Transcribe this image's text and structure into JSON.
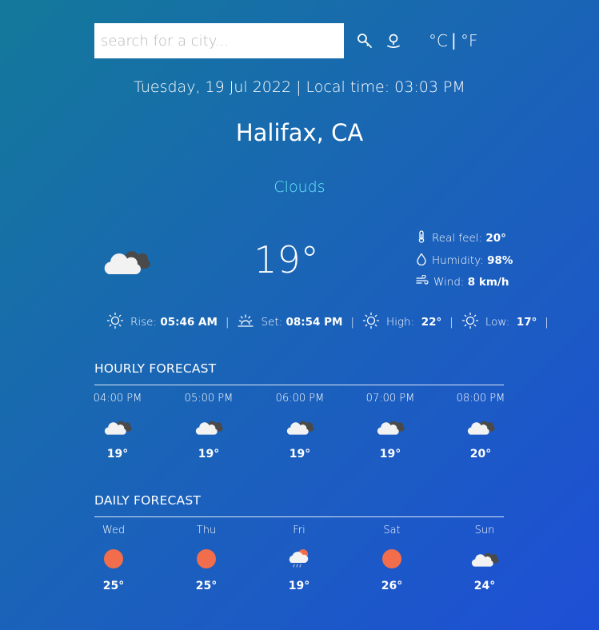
{
  "search": {
    "placeholder": "search for a city..."
  },
  "icons": {
    "search": "search-icon",
    "location": "location-icon",
    "thermometer": "thermometer-icon",
    "humidity": "droplet-icon",
    "wind": "wind-icon",
    "sun": "sun-icon",
    "sunset": "sunset-icon"
  },
  "units": {
    "celsius": "°C",
    "separator": "|",
    "fahrenheit": "°F"
  },
  "datetime": "Tuesday, 19 Jul 2022 | Local time: 03:03 PM",
  "city": "Halifax, CA",
  "condition": "Clouds",
  "current": {
    "temp": "19°",
    "icon": "clouds-icon",
    "real_feel_label": "Real feel:",
    "real_feel_value": "20°",
    "humidity_label": "Humidity:",
    "humidity_value": "98%",
    "wind_label": "Wind:",
    "wind_value": "8 km/h"
  },
  "sun": {
    "rise_label": "Rise:",
    "rise_value": "05:46 AM",
    "set_label": "Set:",
    "set_value": "08:54 PM",
    "high_label": "High:",
    "high_value": "22°",
    "low_label": "Low:",
    "low_value": "17°",
    "separator": "|"
  },
  "hourly": {
    "title": "HOURLY FORECAST",
    "items": [
      {
        "time": "04:00 PM",
        "icon": "clouds-icon",
        "temp": "19°"
      },
      {
        "time": "05:00 PM",
        "icon": "clouds-icon",
        "temp": "19°"
      },
      {
        "time": "06:00 PM",
        "icon": "clouds-icon",
        "temp": "19°"
      },
      {
        "time": "07:00 PM",
        "icon": "clouds-icon",
        "temp": "19°"
      },
      {
        "time": "08:00 PM",
        "icon": "clouds-icon",
        "temp": "20°"
      }
    ]
  },
  "daily": {
    "title": "DAILY FORECAST",
    "items": [
      {
        "day": "Wed",
        "icon": "sun-clear-icon",
        "temp": "25°"
      },
      {
        "day": "Thu",
        "icon": "sun-clear-icon",
        "temp": "25°"
      },
      {
        "day": "Fri",
        "icon": "rain-sun-icon",
        "temp": "19°"
      },
      {
        "day": "Sat",
        "icon": "sun-clear-icon",
        "temp": "26°"
      },
      {
        "day": "Sun",
        "icon": "clouds-icon",
        "temp": "24°"
      }
    ]
  },
  "colors": {
    "accent": "#67e8f9",
    "sun": "#f26d4b",
    "cloud_dark": "#4a4a4a",
    "cloud_light": "#f2f2f2"
  }
}
